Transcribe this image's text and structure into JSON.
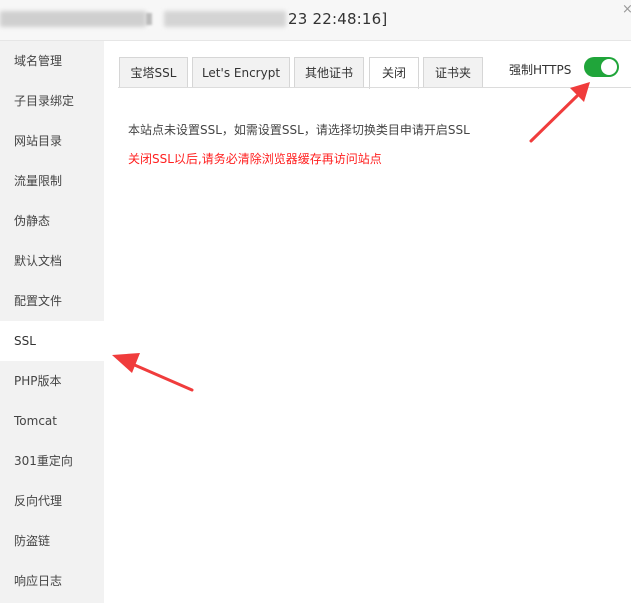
{
  "title": {
    "time_text": "23 22:48:16]",
    "close_glyph": "×"
  },
  "sidebar": {
    "items": [
      {
        "label": "域名管理"
      },
      {
        "label": "子目录绑定"
      },
      {
        "label": "网站目录"
      },
      {
        "label": "流量限制"
      },
      {
        "label": "伪静态"
      },
      {
        "label": "默认文档"
      },
      {
        "label": "配置文件"
      },
      {
        "label": "SSL",
        "active": true
      },
      {
        "label": "PHP版本"
      },
      {
        "label": "Tomcat"
      },
      {
        "label": "301重定向"
      },
      {
        "label": "反向代理"
      },
      {
        "label": "防盗链"
      },
      {
        "label": "响应日志"
      }
    ]
  },
  "tabs": [
    {
      "label": "宝塔SSL"
    },
    {
      "label": "Let's Encrypt"
    },
    {
      "label": "其他证书"
    },
    {
      "label": "关闭",
      "active": true
    },
    {
      "label": "证书夹"
    }
  ],
  "force_https": {
    "label": "强制HTTPS",
    "enabled": true
  },
  "messages": {
    "info": "本站点未设置SSL，如需设置SSL，请选择切换类目申请开启SSL",
    "warning": "关闭SSL以后,请务必清除浏览器缓存再访问站点"
  },
  "colors": {
    "accent": "#20a53a",
    "warning": "#ff2020",
    "arrow": "#f03c3c"
  }
}
